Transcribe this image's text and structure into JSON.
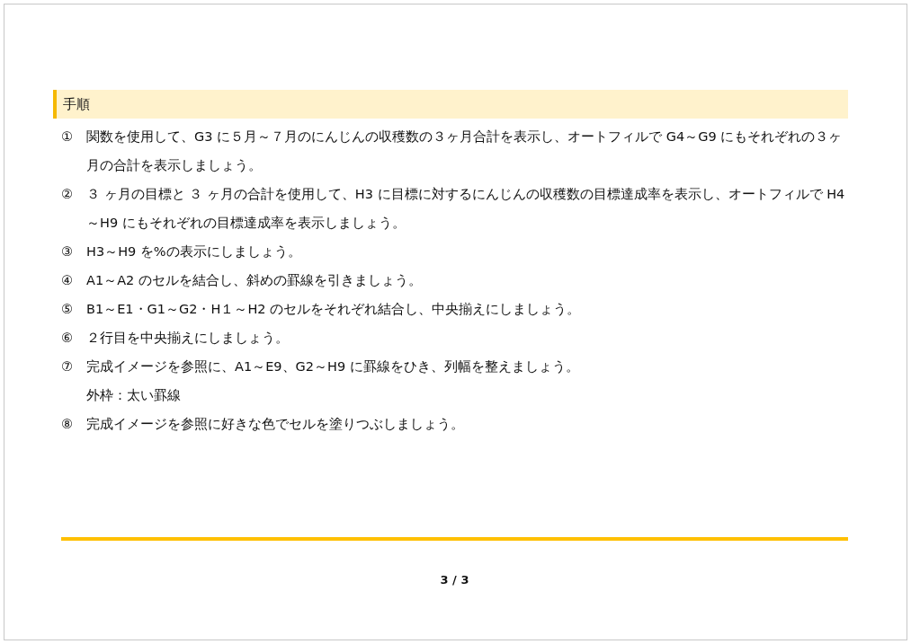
{
  "heading": "手順",
  "steps": [
    {
      "number": "①",
      "text": "関数を使用して、G3 に５月～７月のにんじんの収穫数の３ヶ月合計を表示し、オートフィルで G4～G9 にもそれぞれの３ヶ月の合計を表示しましょう。"
    },
    {
      "number": "②",
      "text": "３ ヶ月の目標と ３ ヶ月の合計を使用して、H3 に目標に対するにんじんの収穫数の目標達成率を表示し、オートフィルで H4～H9 にもそれぞれの目標達成率を表示しましょう。"
    },
    {
      "number": "③",
      "text": "H3～H9 を%の表示にしましょう。"
    },
    {
      "number": "④",
      "text": "A1～A2 のセルを結合し、斜めの罫線を引きましょう。"
    },
    {
      "number": "⑤",
      "text": "B1～E1・G1～G2・H１～H2 のセルをそれぞれ結合し、中央揃えにしましょう。"
    },
    {
      "number": "⑥",
      "text": "２行目を中央揃えにしましょう。"
    },
    {
      "number": "⑦",
      "text": "完成イメージを参照に、A1～E9、G2～H9 に罫線をひき、列幅を整えましょう。",
      "note": "外枠：太い罫線"
    },
    {
      "number": "⑧",
      "text": "完成イメージを参照に好きな色でセルを塗りつぶしましょう。"
    }
  ],
  "page_number": "3 / 3"
}
